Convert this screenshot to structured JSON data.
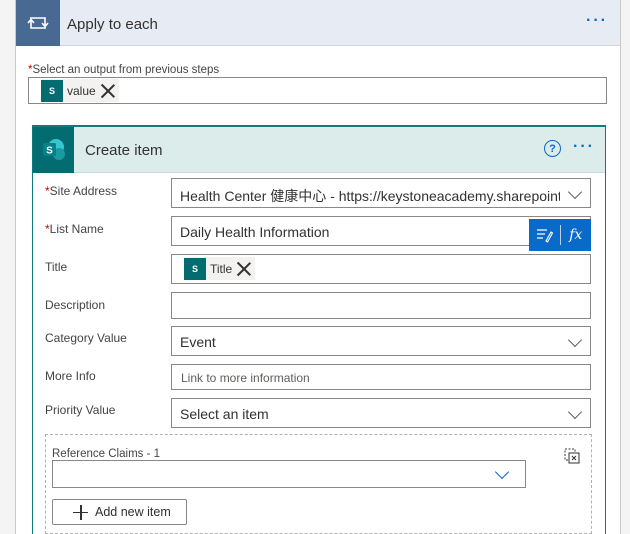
{
  "loop": {
    "title": "Apply to each",
    "more": "···",
    "select_label": "Select an output from previous steps",
    "required_mark": "*",
    "token": {
      "label": "value",
      "icon": "sharepoint-icon"
    }
  },
  "action": {
    "title": "Create item",
    "help": "?",
    "more": "···",
    "icon": "sharepoint-icon",
    "brand_color": "#036c70",
    "accent_color": "#0a6ac9",
    "fields": {
      "site_address": {
        "label": "Site Address",
        "value": "Health Center 健康中心 - https://keystoneacademy.sharepoint...."
      },
      "list_name": {
        "label": "List Name",
        "value": "Daily Health Information"
      },
      "title": {
        "label": "Title",
        "token": "Title"
      },
      "description": {
        "label": "Description",
        "value": ""
      },
      "category_value": {
        "label": "Category Value",
        "value": "Event"
      },
      "more_info": {
        "label": "More Info",
        "placeholder": "Link to more information"
      },
      "priority_value": {
        "label": "Priority Value",
        "value": "Select an item"
      }
    },
    "dynamic_buttons": {
      "content": "dynamic-content-icon",
      "expression": "fx"
    },
    "reference_claims": {
      "label": "Reference Claims - 1",
      "add_label": "Add new item"
    }
  }
}
